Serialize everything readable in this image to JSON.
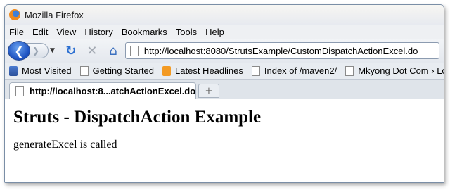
{
  "window": {
    "title": "Mozilla Firefox"
  },
  "menu": [
    "File",
    "Edit",
    "View",
    "History",
    "Bookmarks",
    "Tools",
    "Help"
  ],
  "nav": {
    "back_icon": "back-arrow-icon",
    "forward_icon": "forward-arrow-icon",
    "url": "http://localhost:8080/StrutsExample/CustomDispatchActionExcel.do"
  },
  "bookmarks": [
    {
      "label": "Most Visited",
      "icon": "most-visited-icon"
    },
    {
      "label": "Getting Started",
      "icon": "page-icon"
    },
    {
      "label": "Latest Headlines",
      "icon": "rss-icon"
    },
    {
      "label": "Index of /maven2/",
      "icon": "page-icon"
    },
    {
      "label": "Mkyong Dot Com › Lo...",
      "icon": "page-icon"
    }
  ],
  "tabs": [
    {
      "label": "http://localhost:8...atchActionExcel.do"
    }
  ],
  "page": {
    "heading": "Struts - DispatchAction Example",
    "message": "generateExcel is called"
  }
}
